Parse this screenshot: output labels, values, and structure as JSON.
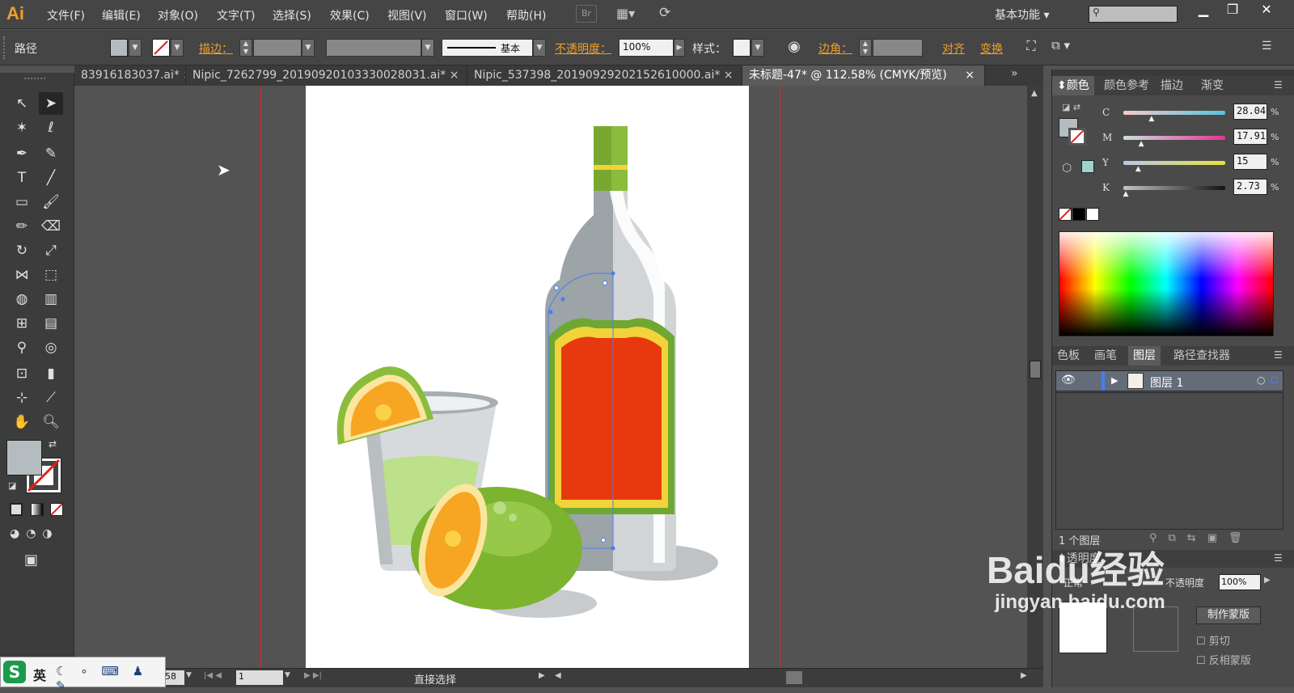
{
  "app": {
    "logo": "Ai",
    "bridge": "Br"
  },
  "menu": [
    "文件(F)",
    "编辑(E)",
    "对象(O)",
    "文字(T)",
    "选择(S)",
    "效果(C)",
    "视图(V)",
    "窗口(W)",
    "帮助(H)"
  ],
  "workspace": "基本功能",
  "control": {
    "object_type": "路径",
    "stroke_label": "描边：",
    "stroke_style": "基本",
    "opacity_label": "不透明度：",
    "opacity_value": "100%",
    "style_label": "样式：",
    "corner_label": "边角：",
    "align": "对齐",
    "transform": "变换"
  },
  "tabs": [
    {
      "label": "83916183037.ai*"
    },
    {
      "label": "Nipic_7262799_20190920103330028031.ai*"
    },
    {
      "label": "Nipic_537398_20190929202152610000.ai*"
    },
    {
      "label": "未标题-47* @ 112.58% (CMYK/预览)"
    }
  ],
  "color_panel": {
    "tabs": [
      "颜色",
      "颜色参考",
      "描边",
      "渐变"
    ],
    "channels": [
      {
        "label": "C",
        "value": "28.04",
        "pct": 28.04
      },
      {
        "label": "M",
        "value": "17.91",
        "pct": 17.91
      },
      {
        "label": "Y",
        "value": "15",
        "pct": 15
      },
      {
        "label": "K",
        "value": "2.73",
        "pct": 2.73
      }
    ],
    "percent": "%"
  },
  "layers_panel": {
    "tabs": [
      "色板",
      "画笔",
      "图层",
      "路径查找器"
    ],
    "layer_name": "图层 1",
    "layer_count": "1 个图层"
  },
  "transparency_panel": {
    "title": "透明度",
    "blend_mode": "正常",
    "opacity_label": "不透明度",
    "opacity_value": "100%",
    "make_mask": "制作蒙版",
    "clip": "剪切",
    "invert_mask": "反相蒙版"
  },
  "status": {
    "zoom": "58",
    "page": "1",
    "tool": "直接选择"
  },
  "ime": {
    "lang": "英"
  },
  "watermark": {
    "brand": "Baidu经验",
    "url": "jingyan.baidu.com"
  },
  "colors": {
    "fill": "#b4bcc0",
    "swatch": "#9fd3d0",
    "label_red": "#e8390e",
    "lime": "#8bbd3c"
  }
}
